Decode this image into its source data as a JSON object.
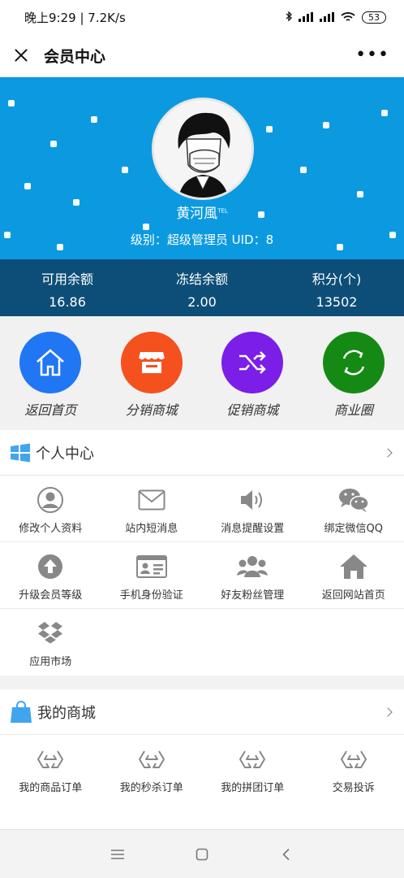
{
  "status": {
    "time": "晚上9:29 | 7.2K/s",
    "battery": "53"
  },
  "nav": {
    "title": "会员中心"
  },
  "user": {
    "name": "黄河風",
    "tm": "TEL",
    "info": "级别：超级管理员 UID：8"
  },
  "balances": [
    {
      "label": "可用余额",
      "value": "16.86"
    },
    {
      "label": "冻结余额",
      "value": "2.00"
    },
    {
      "label": "积分(个)",
      "value": "13502"
    }
  ],
  "quick": [
    {
      "label": "返回首页",
      "color": "#2176f3",
      "icon": "home-icon"
    },
    {
      "label": "分销商城",
      "color": "#f4511e",
      "icon": "store-icon"
    },
    {
      "label": "促销商城",
      "color": "#7a1ee8",
      "icon": "shuffle-icon"
    },
    {
      "label": "商业圈",
      "color": "#148a14",
      "icon": "refresh-icon"
    }
  ],
  "personal": {
    "title": "个人中心",
    "items": [
      {
        "label": "修改个人资料",
        "icon": "user-icon"
      },
      {
        "label": "站内短消息",
        "icon": "mail-icon"
      },
      {
        "label": "消息提醒设置",
        "icon": "volume-icon"
      },
      {
        "label": "绑定微信QQ",
        "icon": "wechat-icon"
      },
      {
        "label": "升级会员等级",
        "icon": "upload-icon"
      },
      {
        "label": "手机身份验证",
        "icon": "id-card-icon"
      },
      {
        "label": "好友粉丝管理",
        "icon": "users-icon"
      },
      {
        "label": "返回网站首页",
        "icon": "house-icon"
      },
      {
        "label": "应用市场",
        "icon": "dropbox-icon"
      }
    ]
  },
  "shop": {
    "title": "我的商城",
    "items": [
      {
        "label": "我的商品订单",
        "icon": "order-icon"
      },
      {
        "label": "我的秒杀订单",
        "icon": "order-icon"
      },
      {
        "label": "我的拼团订单",
        "icon": "order-icon"
      },
      {
        "label": "交易投诉",
        "icon": "order-icon"
      }
    ]
  }
}
